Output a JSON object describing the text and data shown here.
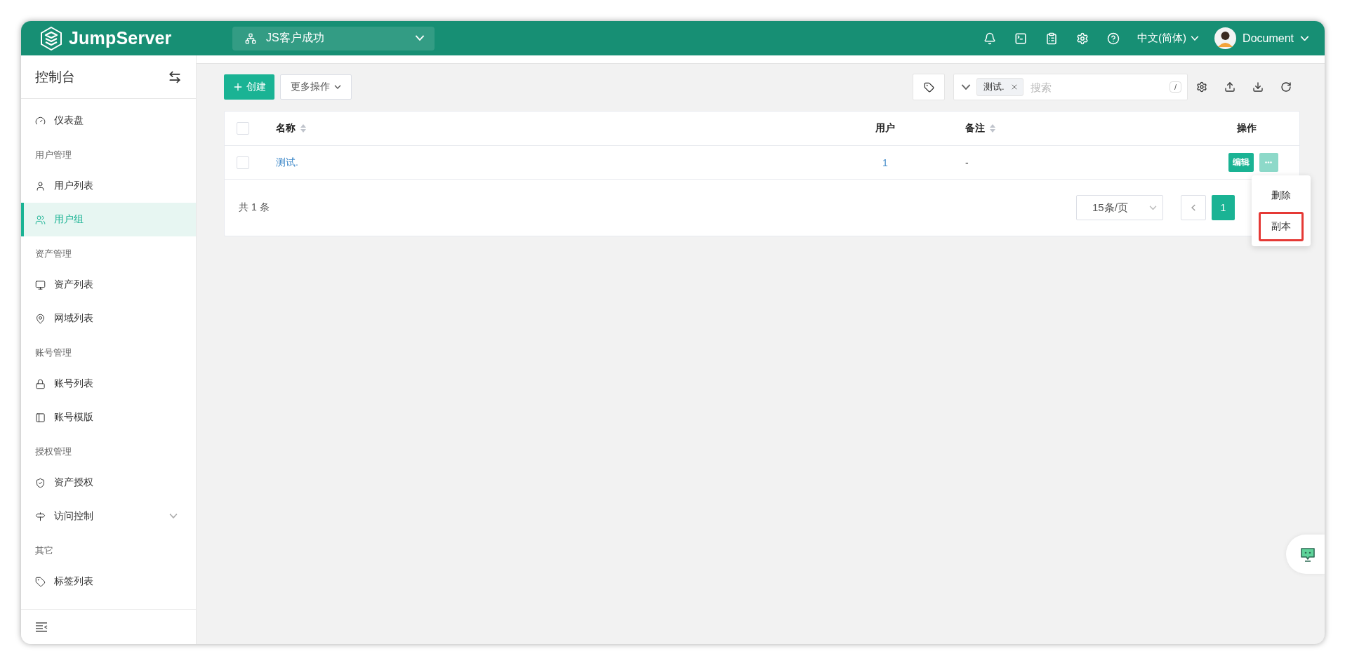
{
  "header": {
    "brand": "JumpServer",
    "organization": "JS客户成功",
    "language": "中文(简体)",
    "user": "Document"
  },
  "sidebar": {
    "title": "控制台",
    "items": [
      {
        "kind": "item",
        "label": "仪表盘",
        "selected": false
      },
      {
        "kind": "group",
        "label": "用户管理"
      },
      {
        "kind": "item",
        "label": "用户列表",
        "selected": false
      },
      {
        "kind": "item",
        "label": "用户组",
        "selected": true
      },
      {
        "kind": "group",
        "label": "资产管理"
      },
      {
        "kind": "item",
        "label": "资产列表",
        "selected": false
      },
      {
        "kind": "item",
        "label": "网域列表",
        "selected": false
      },
      {
        "kind": "group",
        "label": "账号管理"
      },
      {
        "kind": "item",
        "label": "账号列表",
        "selected": false
      },
      {
        "kind": "item",
        "label": "账号模版",
        "selected": false
      },
      {
        "kind": "group",
        "label": "授权管理"
      },
      {
        "kind": "item",
        "label": "资产授权",
        "selected": false
      },
      {
        "kind": "submenu",
        "label": "访问控制",
        "selected": false,
        "expanded": false
      },
      {
        "kind": "group",
        "label": "其它"
      },
      {
        "kind": "item",
        "label": "标签列表",
        "selected": false
      }
    ]
  },
  "toolbar": {
    "create": "创建",
    "more_actions": "更多操作",
    "filter_chip": "测试.",
    "search_placeholder": "搜索",
    "shortcut": "/"
  },
  "table": {
    "header_checked": false,
    "columns": [
      {
        "label": "名称",
        "sortable": true
      },
      {
        "label": "用户",
        "sortable": false
      },
      {
        "label": "备注",
        "sortable": true
      },
      {
        "label": "操作",
        "sortable": false
      }
    ],
    "rows": [
      {
        "selected": false,
        "name": "测试.",
        "users": "1",
        "comment": "-",
        "edit": "编辑"
      }
    ]
  },
  "footer": {
    "total": "共 1 条",
    "page_size": "15条/页",
    "pages": [
      {
        "label": "1",
        "selected": true
      }
    ]
  },
  "action_menu": {
    "items": [
      {
        "label": "删除",
        "highlighted": false
      },
      {
        "label": "副本",
        "highlighted": true
      }
    ]
  }
}
